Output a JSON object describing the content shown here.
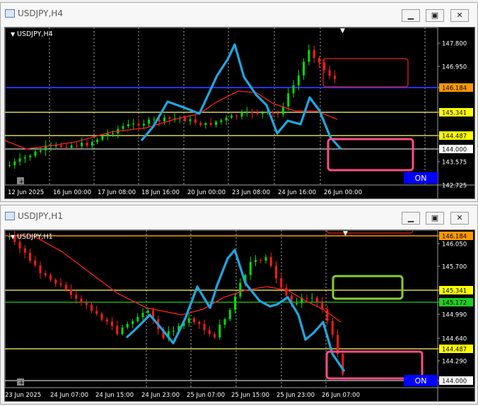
{
  "windows": [
    {
      "title": "USDJPY,H4",
      "label": "USDJPY,H4",
      "price_ticks": [
        "147.800",
        "146.950",
        "146.184",
        "145.341",
        "144.487",
        "144.000",
        "143.575",
        "142.725"
      ],
      "time_ticks": [
        "12 Jun 2025",
        "16 Jun 00:00",
        "17 Jun 08:00",
        "18 Jun 16:00",
        "20 Jun 00:00",
        "23 Jun 08:00",
        "24 Jun 16:00",
        "26 Jun 00:00"
      ],
      "on_label": "ON"
    },
    {
      "title": "USDJPY,H1",
      "label": "USDJPY,H1",
      "price_ticks": [
        "146.184",
        "146.050",
        "145.700",
        "145.341",
        "145.172",
        "144.990",
        "144.640",
        "144.487",
        "144.290",
        "144.000"
      ],
      "time_ticks": [
        "23 Jun 2025",
        "24 Jun 07:00",
        "24 Jun 15:00",
        "24 Jun 23:00",
        "25 Jun 07:00",
        "25 Jun 15:00",
        "25 Jun 23:00",
        "26 Jun 07:00"
      ],
      "on_label": "ON"
    }
  ],
  "colors": {
    "bull": "#00e000",
    "bear": "#ff1a1a",
    "ma": "#ff2020",
    "zigzag": "#1ea7e1",
    "yellow_line": "#ffff66",
    "blue_line": "#2233ff",
    "orange_line": "#ff9900",
    "green_line": "#22cc22",
    "box_red": "#e0202a",
    "box_pink": "#ff4d88",
    "box_green": "#88cc33",
    "on_button": "#0000ff"
  }
}
